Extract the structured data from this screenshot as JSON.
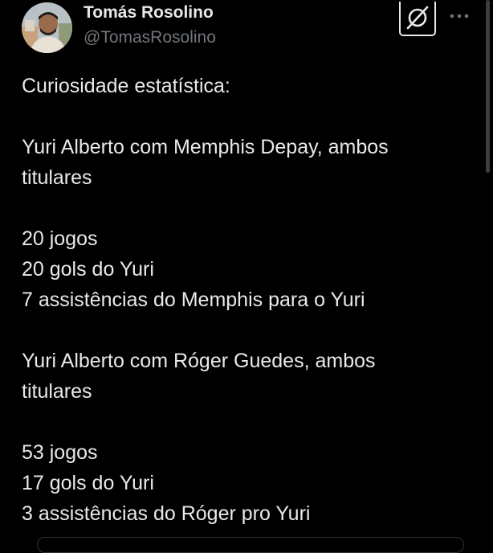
{
  "author": {
    "display_name": "Tomás Rosolino",
    "handle": "@TomasRosolino"
  },
  "actions": {
    "grok_icon": "grok-icon",
    "more_icon": "more-icon"
  },
  "tweet": {
    "lines": [
      "Curiosidade estatística:",
      "",
      "Yuri Alberto com Memphis Depay, ambos",
      "titulares",
      "",
      "20 jogos",
      "20 gols do Yuri",
      "7 assistências do Memphis para o Yuri",
      "",
      "Yuri Alberto com Róger Guedes, ambos",
      "titulares",
      "",
      "53 jogos",
      "17 gols do Yuri",
      "3 assistências do Róger pro Yuri"
    ]
  },
  "colors": {
    "background": "#000000",
    "text": "#e7e9ea",
    "muted": "#71767b"
  }
}
